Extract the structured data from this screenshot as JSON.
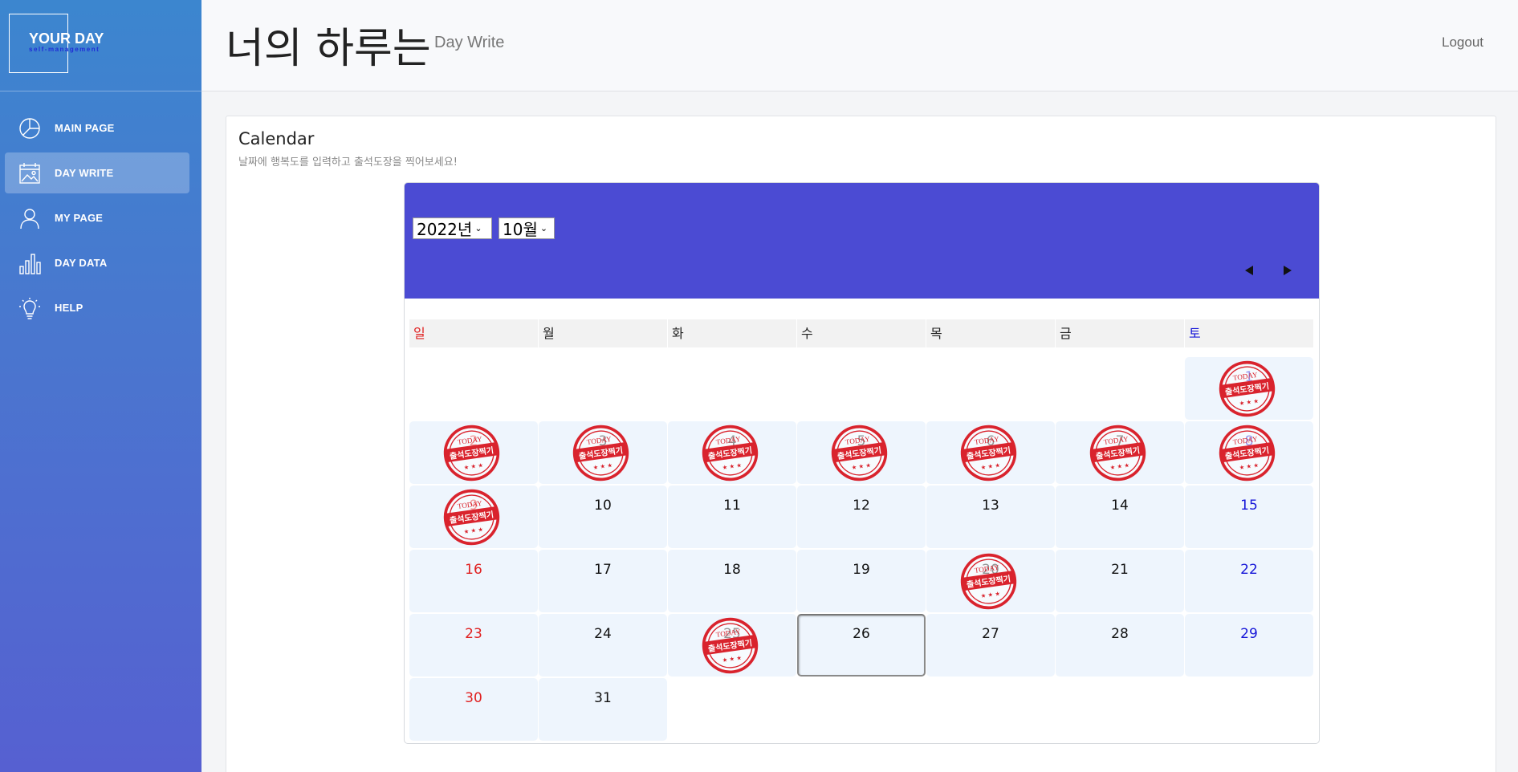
{
  "sidebar": {
    "logo_title": "YOUR DAY",
    "logo_sub": "self-management",
    "items": [
      {
        "label": "MAIN PAGE",
        "icon": "pie-chart-icon",
        "active": false
      },
      {
        "label": "DAY WRITE",
        "icon": "calendar-image-icon",
        "active": true
      },
      {
        "label": "MY PAGE",
        "icon": "user-icon",
        "active": false
      },
      {
        "label": "DAY DATA",
        "icon": "bar-chart-icon",
        "active": false
      },
      {
        "label": "HELP",
        "icon": "lightbulb-icon",
        "active": false
      }
    ]
  },
  "header": {
    "title": "너의 하루는",
    "subtitle": "Day Write",
    "logout": "Logout"
  },
  "card": {
    "title": "Calendar",
    "description": "날짜에 행복도를 입력하고 출석도장을 찍어보세요!"
  },
  "calendar": {
    "year_label": "2022년",
    "month_label": "10월",
    "weekdays": [
      "일",
      "월",
      "화",
      "수",
      "목",
      "금",
      "토"
    ],
    "weeks": [
      [
        null,
        null,
        null,
        null,
        null,
        null,
        1
      ],
      [
        2,
        3,
        4,
        5,
        6,
        7,
        8
      ],
      [
        9,
        10,
        11,
        12,
        13,
        14,
        15
      ],
      [
        16,
        17,
        18,
        19,
        20,
        21,
        22
      ],
      [
        23,
        24,
        25,
        26,
        27,
        28,
        29
      ],
      [
        30,
        31,
        null,
        null,
        null,
        null,
        null
      ]
    ],
    "stamped_days": [
      1,
      2,
      3,
      4,
      5,
      6,
      7,
      8,
      9,
      20,
      25
    ],
    "today": 26,
    "stamp": {
      "top_text": "TODAY",
      "main_text": "출석도장찍기",
      "color": "#d9232d"
    },
    "header_color": "#4b4bd3",
    "sunday_color": "#e02020",
    "saturday_color": "#1515d8"
  }
}
